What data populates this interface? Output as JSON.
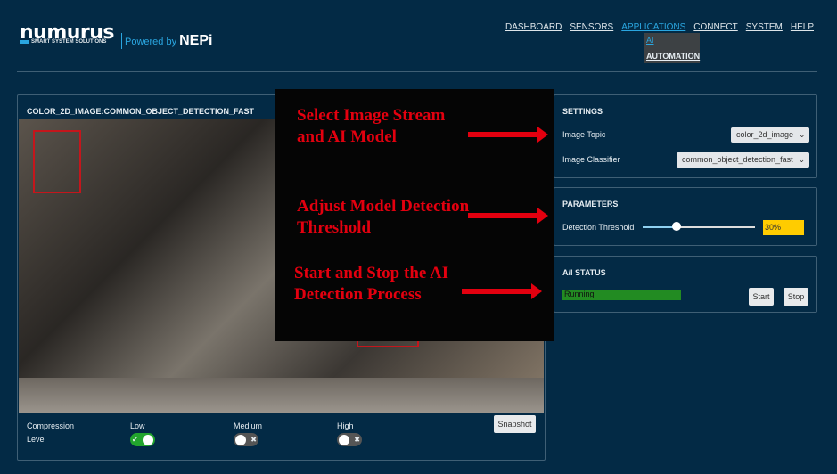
{
  "header": {
    "logo": "numurus",
    "tagline": "SMART SYSTEM SOLUTIONS",
    "powered_by": "Powered by",
    "brand": "NEPi"
  },
  "nav": {
    "items": [
      "DASHBOARD",
      "SENSORS",
      "APPLICATIONS",
      "CONNECT",
      "SYSTEM",
      "HELP"
    ],
    "active": "APPLICATIONS",
    "submenu": [
      "AI",
      "AUTOMATION"
    ]
  },
  "image_panel": {
    "title": "COLOR_2D_IMAGE:COMMON_OBJECT_DETECTION_FAST",
    "compression_label_1": "Compression",
    "compression_label_2": "Level",
    "options": [
      {
        "label": "Low",
        "on": true
      },
      {
        "label": "Medium",
        "on": false
      },
      {
        "label": "High",
        "on": false
      }
    ],
    "snapshot": "Snapshot"
  },
  "annotations": [
    "Select Image Stream and AI Model",
    "Adjust Model Detection Threshold",
    "Start and Stop the AI Detection Process"
  ],
  "settings": {
    "title": "SETTINGS",
    "image_topic_label": "Image Topic",
    "image_topic": "color_2d_image",
    "classifier_label": "Image Classifier",
    "classifier": "common_object_detection_fast"
  },
  "parameters": {
    "title": "PARAMETERS",
    "threshold_label": "Detection Threshold",
    "threshold_value": "30%",
    "threshold_fraction": 0.3
  },
  "status": {
    "title": "A/I STATUS",
    "state": "Running",
    "start": "Start",
    "stop": "Stop",
    "colors": {
      "running": "#228b22",
      "threshold": "#ffcc00"
    }
  }
}
